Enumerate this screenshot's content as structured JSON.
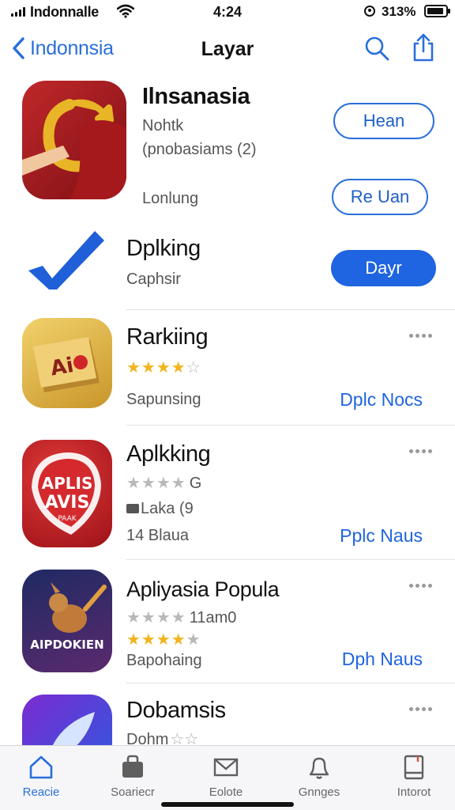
{
  "status": {
    "carrier": "Indonnalle",
    "time": "4:24",
    "battery": "313%"
  },
  "nav": {
    "back_label": "Indonnsia",
    "title": "Layar"
  },
  "apps": [
    {
      "name": "Ilnsanasia",
      "line1": "Nohtk",
      "line2": "(pnobasiams (2)",
      "line3": "Lonlung",
      "button1": "Hean",
      "button2": "Re Uan"
    },
    {
      "name": "Dplking",
      "sub": "Caphsir",
      "button": "Dayr"
    },
    {
      "name": "Rarkiing",
      "rating": 4,
      "sub": "Sapunsing",
      "link": "Dplc Nocs"
    },
    {
      "name": "Aplkking",
      "rating": 4,
      "rating_text": "G",
      "line1": "Laka (9",
      "line2": "14 Blaua",
      "link": "Pplc Naus",
      "icon_text1": "APLIS",
      "icon_text2": "AVIS",
      "icon_text3": "PAAK"
    },
    {
      "name": "Apliyasia Popula",
      "rating": 4,
      "rating_text": "11am0",
      "rating2": 4,
      "sub": "Bapohaing",
      "link": "Dph Naus",
      "icon_text": "AIPDOKIEN"
    },
    {
      "name": "Dobamsis",
      "sub": "Dohm"
    }
  ],
  "tabs": [
    {
      "label": "Reacie",
      "active": true
    },
    {
      "label": "Soariecr"
    },
    {
      "label": "Eolote"
    },
    {
      "label": "Gnnges"
    },
    {
      "label": "Intorot"
    }
  ],
  "colors": {
    "accent": "#2a6fdb",
    "button_fill": "#1f64e0",
    "star": "#f2b31b"
  }
}
